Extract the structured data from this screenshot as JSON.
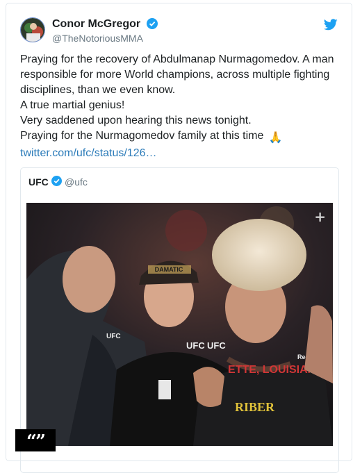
{
  "tweet": {
    "author_name": "Conor McGregor",
    "author_handle": "@TheNotoriousMMA",
    "text_lines": [
      "Praying for the recovery of Abdulmanap Nurmagomedov. A man",
      "responsible for more World champions, across multiple fighting",
      "disciplines, than we even know.",
      "A true martial genius!",
      "Very saddened upon hearing this news tonight.",
      "Praying for the Nurmagomedov family at this time"
    ],
    "emoji": "🙏",
    "link": "twitter.com/ufc/status/126…"
  },
  "quoted_tweet": {
    "author_name": "UFC",
    "author_handle": "@ufc"
  },
  "media": {
    "expand_symbol": "+",
    "quote_badge": "“”"
  },
  "colors": {
    "twitter_blue": "#1da1f2",
    "link": "#2b7bb9",
    "secondary_text": "#697882"
  }
}
